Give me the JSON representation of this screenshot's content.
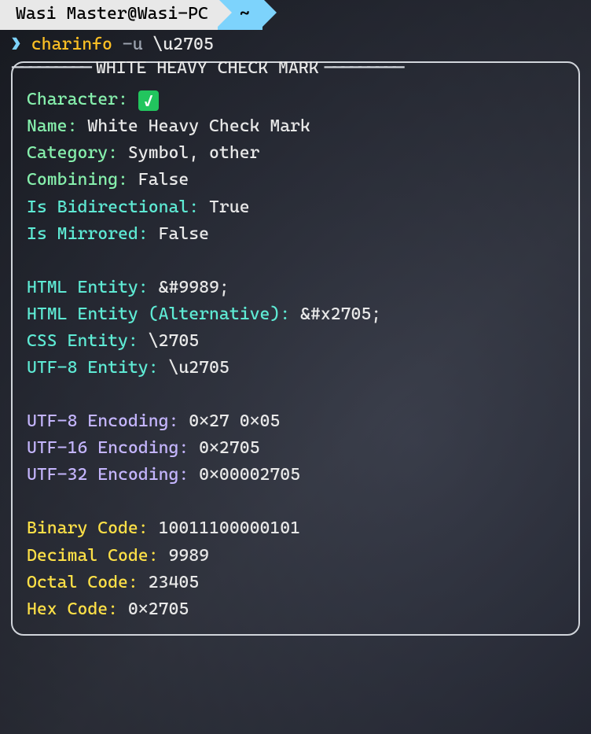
{
  "prompt": {
    "user_host": "Wasi Master@Wasi-PC",
    "path": "~",
    "symbol": "❯"
  },
  "command": {
    "name": "charinfo",
    "flag": "-u",
    "arg": "\\u2705"
  },
  "panel": {
    "title": "WHITE HEAVY CHECK MARK",
    "rows": {
      "character_label": "Character:",
      "character_glyph": "✓",
      "name_label": "Name:",
      "name_value": "White Heavy Check Mark",
      "category_label": "Category:",
      "category_value": "Symbol, other",
      "combining_label": "Combining:",
      "combining_value": "False",
      "bidi_label": "Is Bidirectional:",
      "bidi_value": "True",
      "mirrored_label": "Is Mirrored:",
      "mirrored_value": "False",
      "html_entity_label": "HTML Entity:",
      "html_entity_value": "&#9989;",
      "html_entity_alt_label": "HTML Entity (Alternative):",
      "html_entity_alt_value": "&#x2705;",
      "css_entity_label": "CSS Entity:",
      "css_entity_value": "\\2705",
      "utf8_entity_label": "UTF-8 Entity:",
      "utf8_entity_value": "\\u2705",
      "utf8_enc_label": "UTF-8 Encoding:",
      "utf8_enc_value": "0×27 0×05",
      "utf16_enc_label": "UTF-16 Encoding:",
      "utf16_enc_value": "0×2705",
      "utf32_enc_label": "UTF-32 Encoding:",
      "utf32_enc_value": "0×00002705",
      "binary_label": "Binary Code:",
      "binary_value": "10011100000101",
      "decimal_label": "Decimal Code:",
      "decimal_value": "9989",
      "octal_label": "Octal Code:",
      "octal_value": "23405",
      "hex_label": "Hex Code:",
      "hex_value": "0×2705"
    }
  }
}
